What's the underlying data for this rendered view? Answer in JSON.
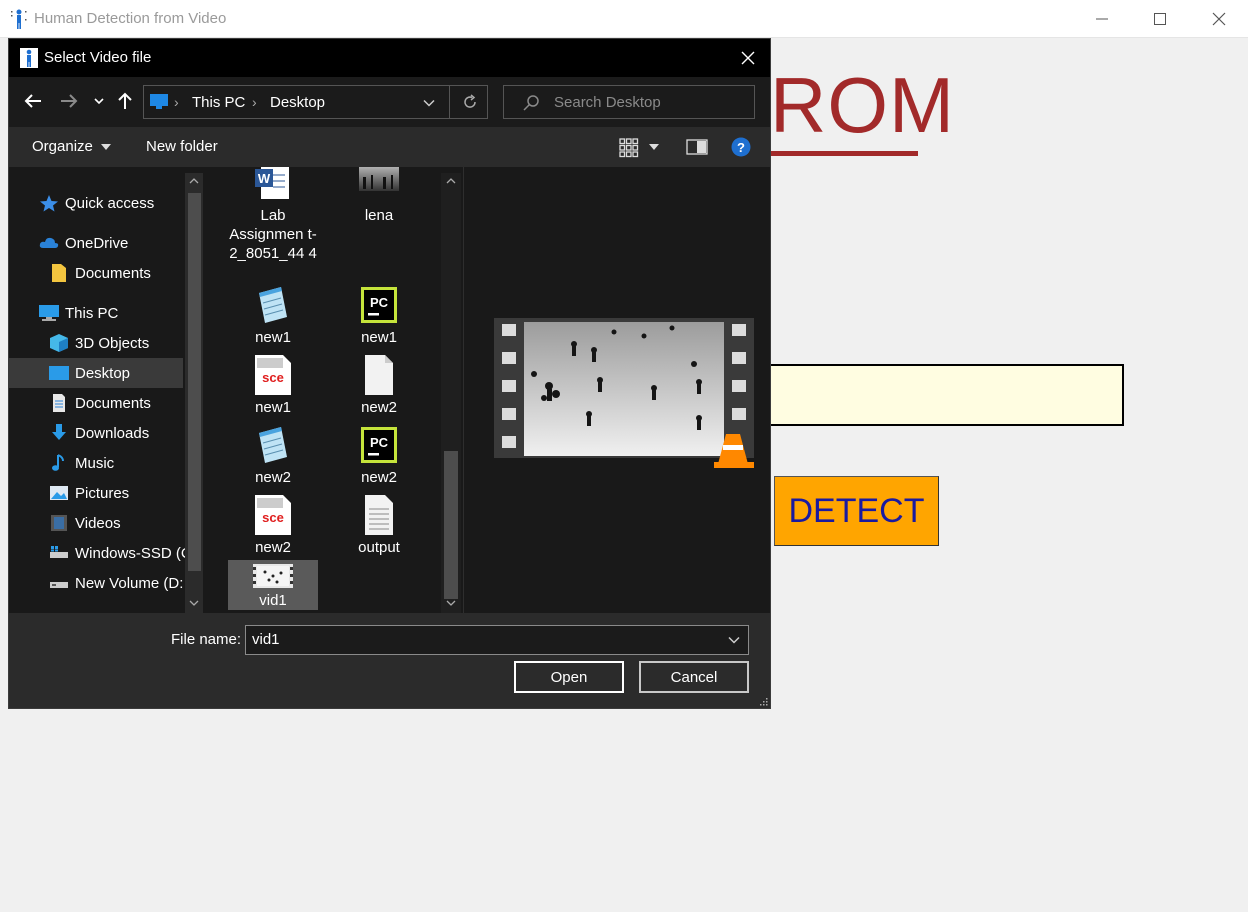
{
  "app": {
    "title": "Human Detection from Video",
    "heading_fragment": "ROM",
    "detect_label": "DETECT"
  },
  "dialog": {
    "title": "Select Video file",
    "address": [
      "This PC",
      "Desktop"
    ],
    "search_placeholder": "Search Desktop",
    "toolbar": {
      "organize": "Organize",
      "new_folder": "New folder"
    },
    "nav_items": [
      {
        "label": "Quick access",
        "icon": "star-icon"
      },
      {
        "label": "OneDrive",
        "icon": "cloud-icon"
      },
      {
        "label": "Documents",
        "icon": "folder-icon"
      },
      {
        "label": "This PC",
        "icon": "computer-icon"
      },
      {
        "label": "3D Objects",
        "icon": "cube-icon"
      },
      {
        "label": "Desktop",
        "icon": "desktop-icon",
        "selected": true
      },
      {
        "label": "Documents",
        "icon": "documents-icon"
      },
      {
        "label": "Downloads",
        "icon": "download-icon"
      },
      {
        "label": "Music",
        "icon": "music-icon"
      },
      {
        "label": "Pictures",
        "icon": "pictures-icon"
      },
      {
        "label": "Videos",
        "icon": "videos-icon"
      },
      {
        "label": "Windows-SSD (C",
        "icon": "drive-icon"
      },
      {
        "label": "New Volume (D:",
        "icon": "drive-icon"
      }
    ],
    "files": [
      {
        "label": "Lab Assignmen t-2_8051_44 4",
        "icon": "word-icon"
      },
      {
        "label": "lena",
        "icon": "image-icon"
      },
      {
        "label": "new1",
        "icon": "notepad-icon"
      },
      {
        "label": "new1",
        "icon": "pycharm-icon"
      },
      {
        "label": "new1",
        "icon": "scilab-icon"
      },
      {
        "label": "new2",
        "icon": "blank-file-icon"
      },
      {
        "label": "new2",
        "icon": "notepad-icon"
      },
      {
        "label": "new2",
        "icon": "pycharm-icon"
      },
      {
        "label": "new2",
        "icon": "scilab-icon"
      },
      {
        "label": "output",
        "icon": "text-file-icon"
      },
      {
        "label": "vid1",
        "icon": "video-icon",
        "selected": true
      }
    ],
    "file_name_label": "File name:",
    "file_name_value": "vid1",
    "open_label": "Open",
    "cancel_label": "Cancel"
  }
}
